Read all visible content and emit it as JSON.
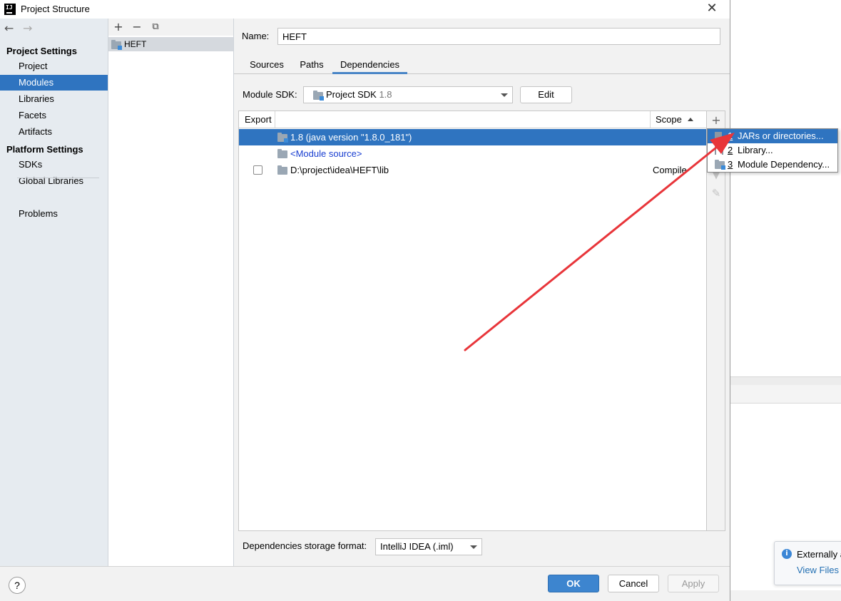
{
  "window": {
    "title": "Project Structure",
    "close_glyph": "✕",
    "app_logo_text": "IJ"
  },
  "nav": {
    "back": "←",
    "forward": "→",
    "project_settings_header": "Project Settings",
    "items_project": [
      "Project",
      "Modules",
      "Libraries",
      "Facets",
      "Artifacts"
    ],
    "selected": "Modules",
    "platform_settings_header": "Platform Settings",
    "items_platform": [
      "SDKs",
      "Global Libraries"
    ],
    "problems": "Problems"
  },
  "modules": {
    "toolbar": {
      "add": "+",
      "remove": "−",
      "copy": "⧉"
    },
    "items": [
      "HEFT"
    ]
  },
  "module": {
    "name_label": "Name:",
    "name_value": "HEFT",
    "tabs": [
      "Sources",
      "Paths",
      "Dependencies"
    ],
    "active_tab": "Dependencies",
    "sdk_label": "Module SDK:",
    "sdk_value": "Project SDK",
    "sdk_version": "1.8",
    "edit_button": "Edit"
  },
  "dependencies": {
    "columns": {
      "export": "Export",
      "scope": "Scope"
    },
    "rows": [
      {
        "text": "1.8 (java version \"1.8.0_181\")",
        "scope": "",
        "selected": true
      },
      {
        "text": "<Module source>",
        "scope": "",
        "selected": false
      },
      {
        "text": "D:\\project\\idea\\HEFT\\lib",
        "scope": "Compile",
        "selected": false
      }
    ],
    "side_toolbar": {
      "add": "+",
      "move_down": "▼",
      "edit": "✎"
    },
    "add_menu": [
      {
        "num": "1",
        "label": "JARs or directories...",
        "icon": "jar-icon"
      },
      {
        "num": "2",
        "label": "Library...",
        "icon": "library-icon"
      },
      {
        "num": "3",
        "label": "Module Dependency...",
        "icon": "module-icon"
      }
    ],
    "storage_format_label": "Dependencies storage format:",
    "storage_format_value": "IntelliJ IDEA (.iml)"
  },
  "buttons": {
    "help": "?",
    "ok": "OK",
    "cancel": "Cancel",
    "apply": "Apply"
  },
  "background": {
    "notification": {
      "text": "Externally a",
      "link": "View Files"
    }
  },
  "colors": {
    "selection": "#2f74c0",
    "annotation_arrow": "#e8353a",
    "link": "#1a3fd1"
  }
}
